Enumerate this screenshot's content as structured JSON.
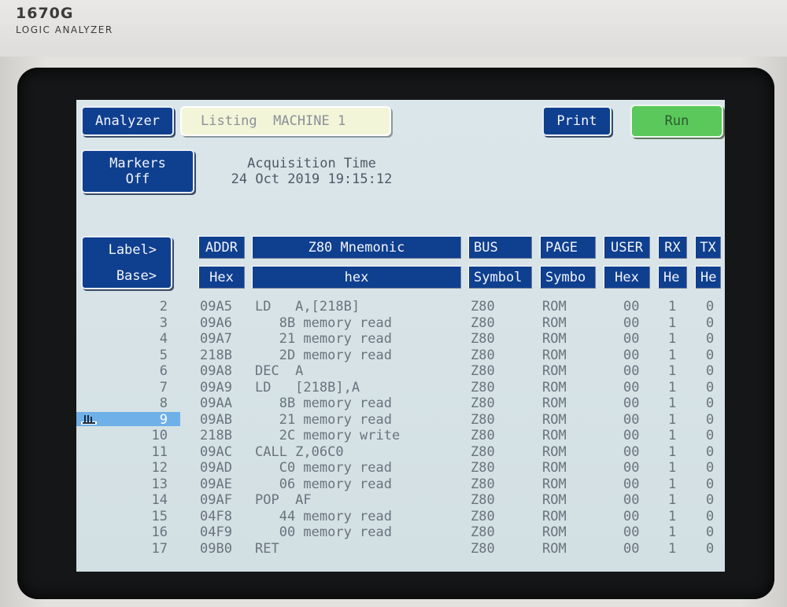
{
  "instrument": {
    "model": "1670G",
    "subtitle": "LOGIC ANALYZER"
  },
  "toolbar": {
    "analyzer_label": "Analyzer",
    "listing_label": "Listing  MACHINE 1",
    "print_label": "Print",
    "run_label": "Run"
  },
  "markers": {
    "label": "Markers\nOff"
  },
  "acquisition": {
    "title": "Acquisition Time",
    "time": "24 Oct 2019 19:15:12"
  },
  "label_base": {
    "label": "Label>",
    "base": "Base>"
  },
  "columns": [
    {
      "label": "ADDR",
      "base": "Hex"
    },
    {
      "label": "Z80 Mnemonic",
      "base": "hex"
    },
    {
      "label": "BUS",
      "base": "Symbol"
    },
    {
      "label": "PAGE",
      "base": "Symbo"
    },
    {
      "label": "USER",
      "base": "Hex"
    },
    {
      "label": "RX",
      "base": "He"
    },
    {
      "label": "TX",
      "base": "He"
    }
  ],
  "rows": [
    {
      "state": "2",
      "addr": "09A5",
      "mnemonic": "LD   A,[218B]",
      "bus": "Z80",
      "page": "ROM",
      "user": "00",
      "rx": "1",
      "tx": "0"
    },
    {
      "state": "3",
      "addr": "09A6",
      "mnemonic": "   8B memory read",
      "bus": "Z80",
      "page": "ROM",
      "user": "00",
      "rx": "1",
      "tx": "0"
    },
    {
      "state": "4",
      "addr": "09A7",
      "mnemonic": "   21 memory read",
      "bus": "Z80",
      "page": "ROM",
      "user": "00",
      "rx": "1",
      "tx": "0"
    },
    {
      "state": "5",
      "addr": "218B",
      "mnemonic": "   2D memory read",
      "bus": "Z80",
      "page": "ROM",
      "user": "00",
      "rx": "1",
      "tx": "0"
    },
    {
      "state": "6",
      "addr": "09A8",
      "mnemonic": "DEC  A",
      "bus": "Z80",
      "page": "ROM",
      "user": "00",
      "rx": "1",
      "tx": "0"
    },
    {
      "state": "7",
      "addr": "09A9",
      "mnemonic": "LD   [218B],A",
      "bus": "Z80",
      "page": "ROM",
      "user": "00",
      "rx": "1",
      "tx": "0"
    },
    {
      "state": "8",
      "addr": "09AA",
      "mnemonic": "   8B memory read",
      "bus": "Z80",
      "page": "ROM",
      "user": "00",
      "rx": "1",
      "tx": "0"
    },
    {
      "state": "9",
      "addr": "09AB",
      "mnemonic": "   21 memory read",
      "bus": "Z80",
      "page": "ROM",
      "user": "00",
      "rx": "1",
      "tx": "0",
      "marked": true
    },
    {
      "state": "10",
      "addr": "218B",
      "mnemonic": "   2C memory write",
      "bus": "Z80",
      "page": "ROM",
      "user": "00",
      "rx": "1",
      "tx": "0"
    },
    {
      "state": "11",
      "addr": "09AC",
      "mnemonic": "CALL Z,06C0",
      "bus": "Z80",
      "page": "ROM",
      "user": "00",
      "rx": "1",
      "tx": "0"
    },
    {
      "state": "12",
      "addr": "09AD",
      "mnemonic": "   C0 memory read",
      "bus": "Z80",
      "page": "ROM",
      "user": "00",
      "rx": "1",
      "tx": "0"
    },
    {
      "state": "13",
      "addr": "09AE",
      "mnemonic": "   06 memory read",
      "bus": "Z80",
      "page": "ROM",
      "user": "00",
      "rx": "1",
      "tx": "0"
    },
    {
      "state": "14",
      "addr": "09AF",
      "mnemonic": "POP  AF",
      "bus": "Z80",
      "page": "ROM",
      "user": "00",
      "rx": "1",
      "tx": "0"
    },
    {
      "state": "15",
      "addr": "04F8",
      "mnemonic": "   44 memory read",
      "bus": "Z80",
      "page": "ROM",
      "user": "00",
      "rx": "1",
      "tx": "0"
    },
    {
      "state": "16",
      "addr": "04F9",
      "mnemonic": "   00 memory read",
      "bus": "Z80",
      "page": "ROM",
      "user": "00",
      "rx": "1",
      "tx": "0"
    },
    {
      "state": "17",
      "addr": "09B0",
      "mnemonic": "RET",
      "bus": "Z80",
      "page": "ROM",
      "user": "00",
      "rx": "1",
      "tx": "0"
    }
  ],
  "colors": {
    "button": "#0f3f8f",
    "run": "#5ac85a",
    "listing_field": "#f3f5d8",
    "marker_highlight": "#6fb0e8",
    "screen": "#d6e2e6"
  },
  "icons": {
    "marker": "marker-flag-icon"
  }
}
